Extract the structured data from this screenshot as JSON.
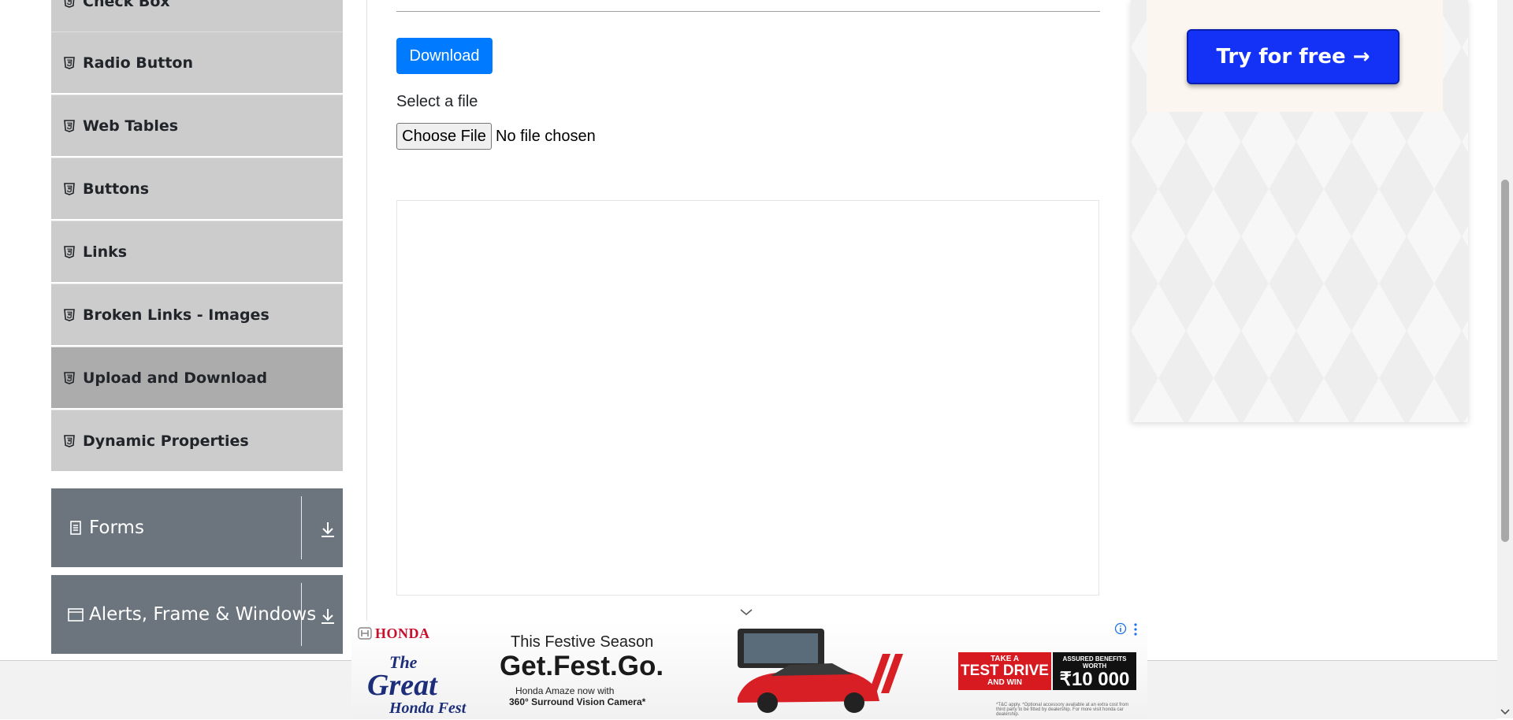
{
  "sidebar": {
    "items": [
      {
        "label": "Check Box",
        "active": false
      },
      {
        "label": "Radio Button",
        "active": false
      },
      {
        "label": "Web Tables",
        "active": false
      },
      {
        "label": "Buttons",
        "active": false
      },
      {
        "label": "Links",
        "active": false
      },
      {
        "label": "Broken Links - Images",
        "active": false
      },
      {
        "label": "Upload and Download",
        "active": true
      },
      {
        "label": "Dynamic Properties",
        "active": false
      }
    ],
    "groups": [
      {
        "label": "Forms",
        "icon": "document-icon"
      },
      {
        "label": "Alerts, Frame & Windows",
        "icon": "window-icon"
      }
    ]
  },
  "main": {
    "download_button": "Download",
    "select_label": "Select a file",
    "file_button": "Choose File",
    "file_status": "No file chosen"
  },
  "ad_right": {
    "cta": "Try for free →",
    "cta_color": "#1432f5"
  },
  "ad_bottom": {
    "brand": "HONDA",
    "fest_line1": "The",
    "fest_line2": "Great",
    "fest_line3": "Honda",
    "fest_line4": "Fest",
    "season": "This Festive Season",
    "headline": "Get.Fest.Go.",
    "sub1": "Honda Amaze now with",
    "sub2": "360° Surround Vision Camera*",
    "drive_top": "TAKE A",
    "drive_mid": "TEST DRIVE",
    "drive_bottom": "AND WIN",
    "benefit_top": "ASSURED BENEFITS WORTH",
    "benefit_value": "₹10 000",
    "terms": "*T&C apply. *Optional accessory available at an extra cost from third party to be fitted by dealership. For more visit honda car dealership."
  },
  "colors": {
    "sidebar_item": "#cccccc",
    "sidebar_active": "#acacac",
    "group_header": "#6c757d",
    "primary": "#007bff"
  }
}
